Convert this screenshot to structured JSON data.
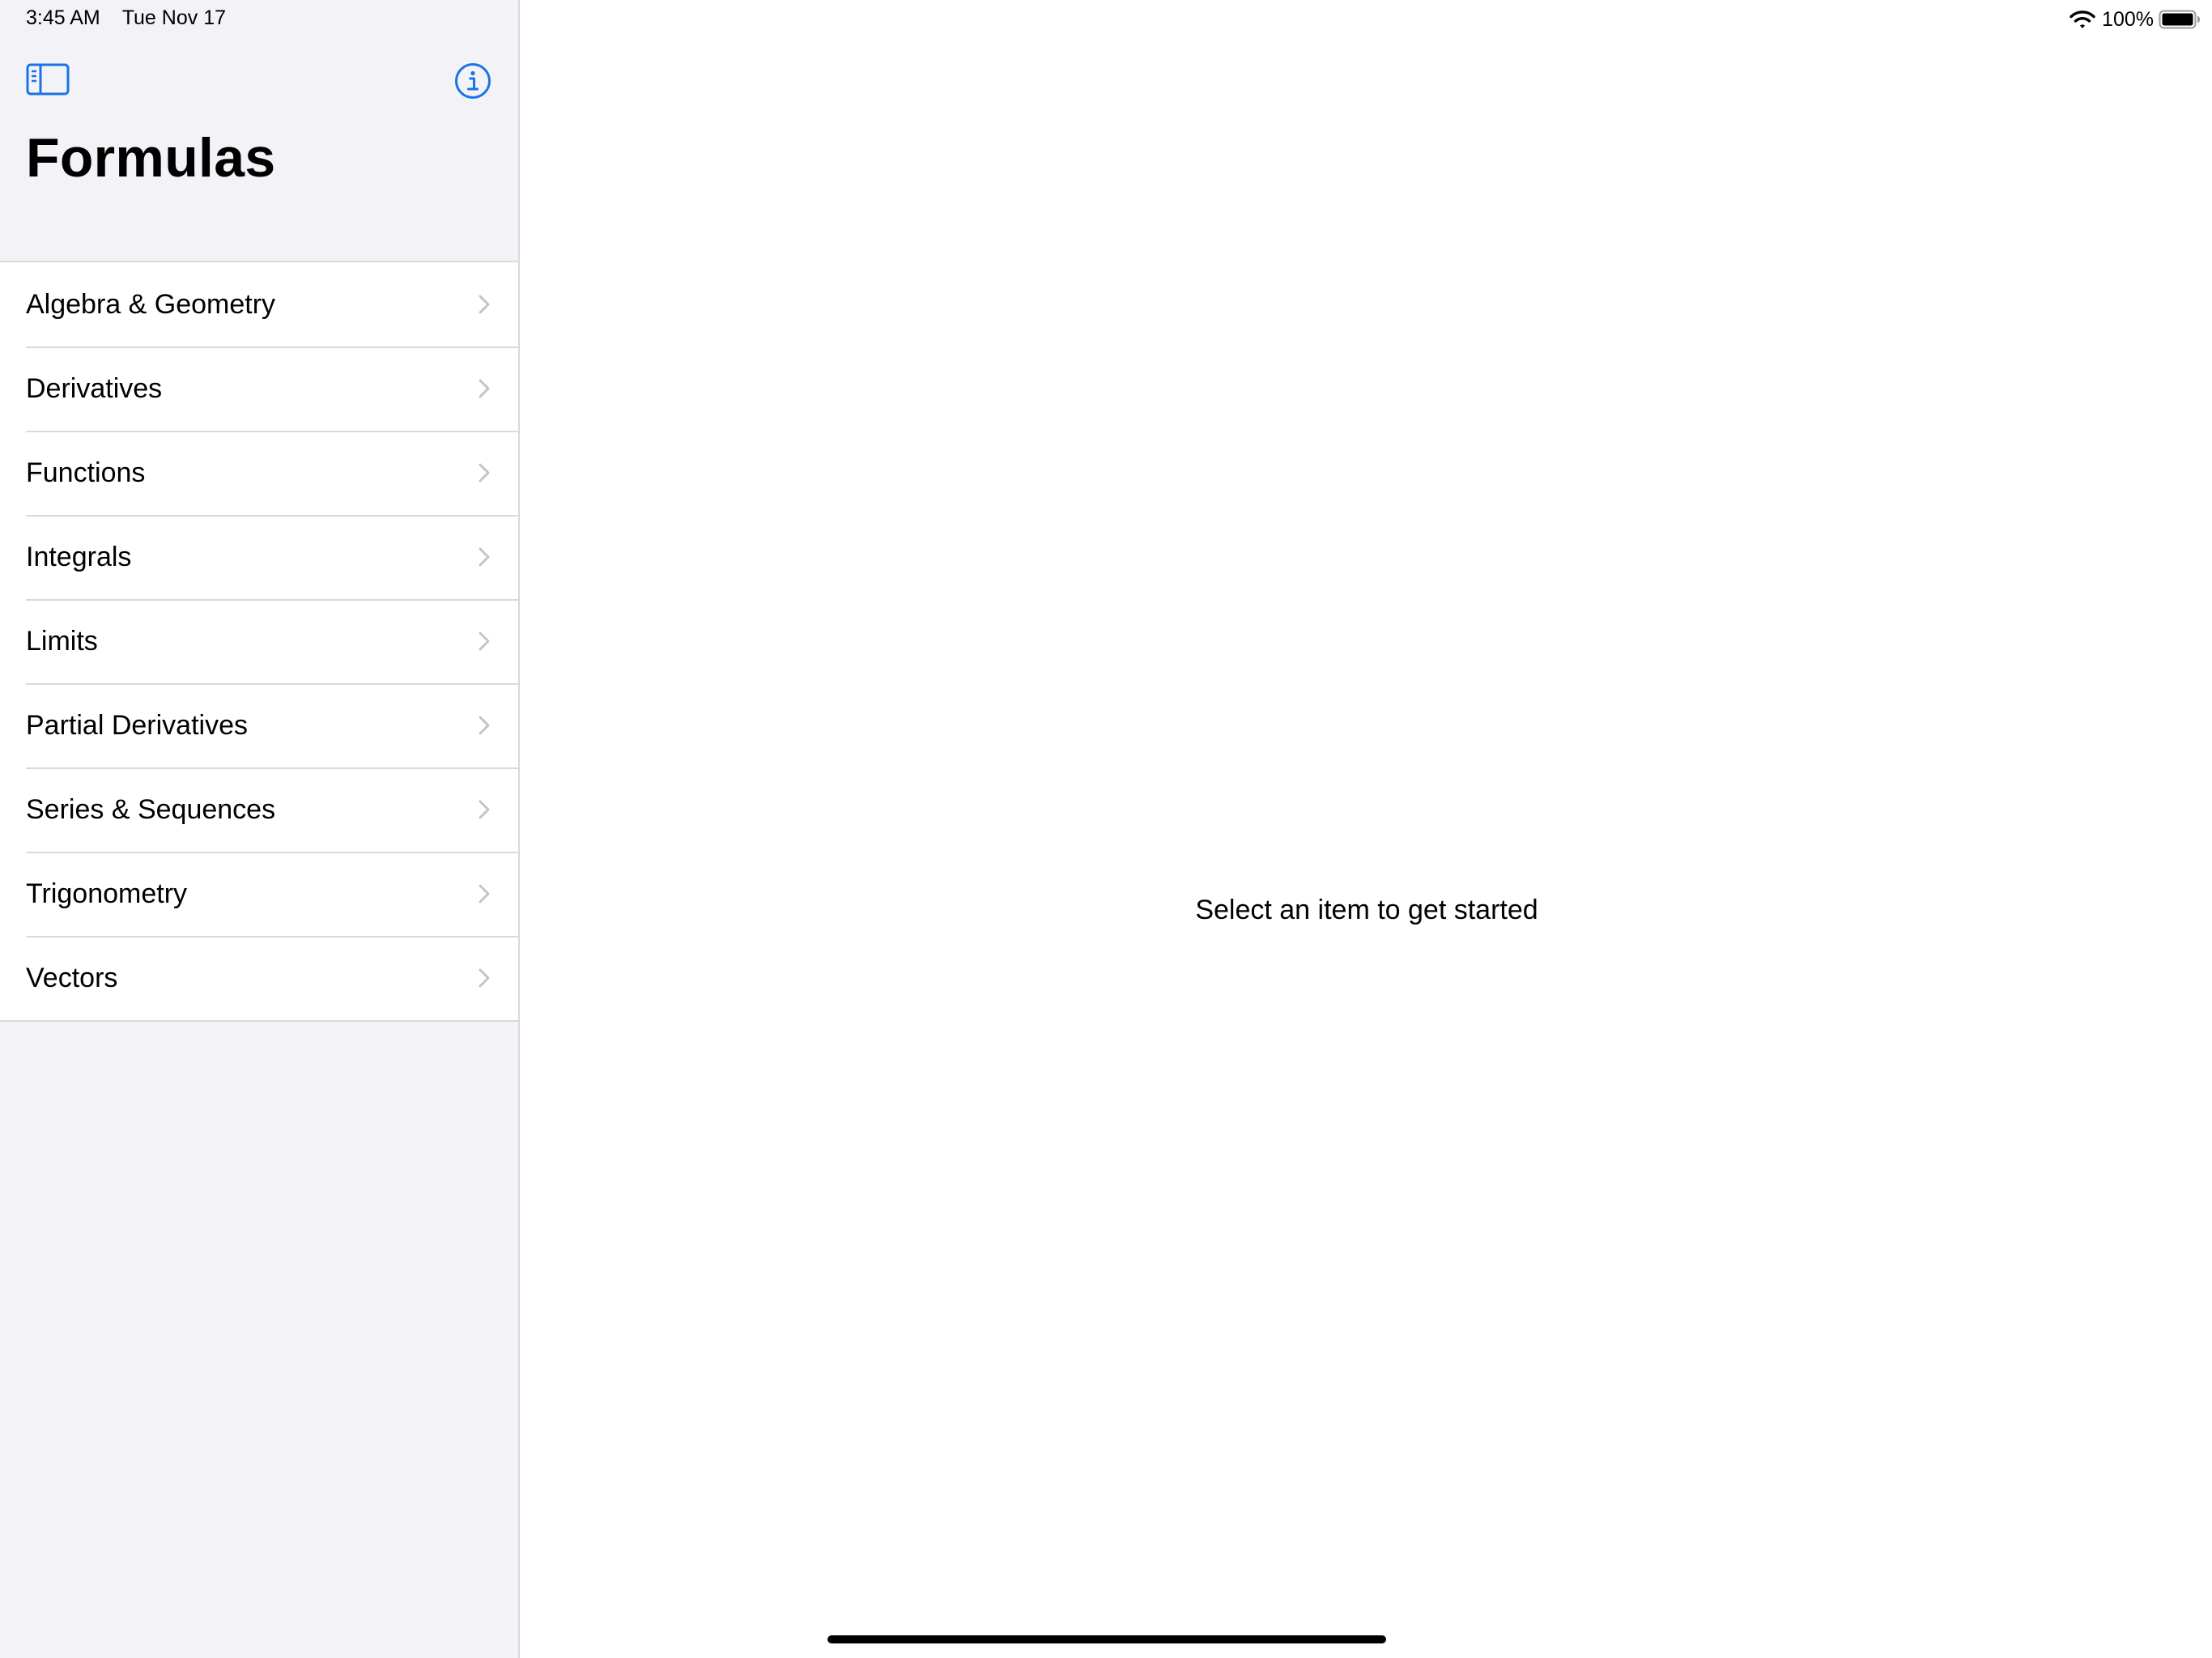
{
  "status_bar": {
    "time": "3:45 AM",
    "date": "Tue Nov 17",
    "battery": "100%"
  },
  "sidebar": {
    "title": "Formulas",
    "items": [
      {
        "label": "Algebra & Geometry"
      },
      {
        "label": "Derivatives"
      },
      {
        "label": "Functions"
      },
      {
        "label": "Integrals"
      },
      {
        "label": "Limits"
      },
      {
        "label": "Partial Derivatives"
      },
      {
        "label": "Series & Sequences"
      },
      {
        "label": "Trigonometry"
      },
      {
        "label": "Vectors"
      }
    ]
  },
  "detail": {
    "placeholder": "Select an item to get started"
  },
  "icons": {
    "sidebar_toggle": "sidebar-toggle-icon",
    "info": "info-icon",
    "chevron": "chevron-right-icon",
    "wifi": "wifi-icon",
    "battery": "battery-icon"
  },
  "colors": {
    "accent": "#1a73e8",
    "sidebar_background": "#f2f2f7",
    "separator": "#d8d8dd",
    "chevron": "#c4c4c7"
  }
}
